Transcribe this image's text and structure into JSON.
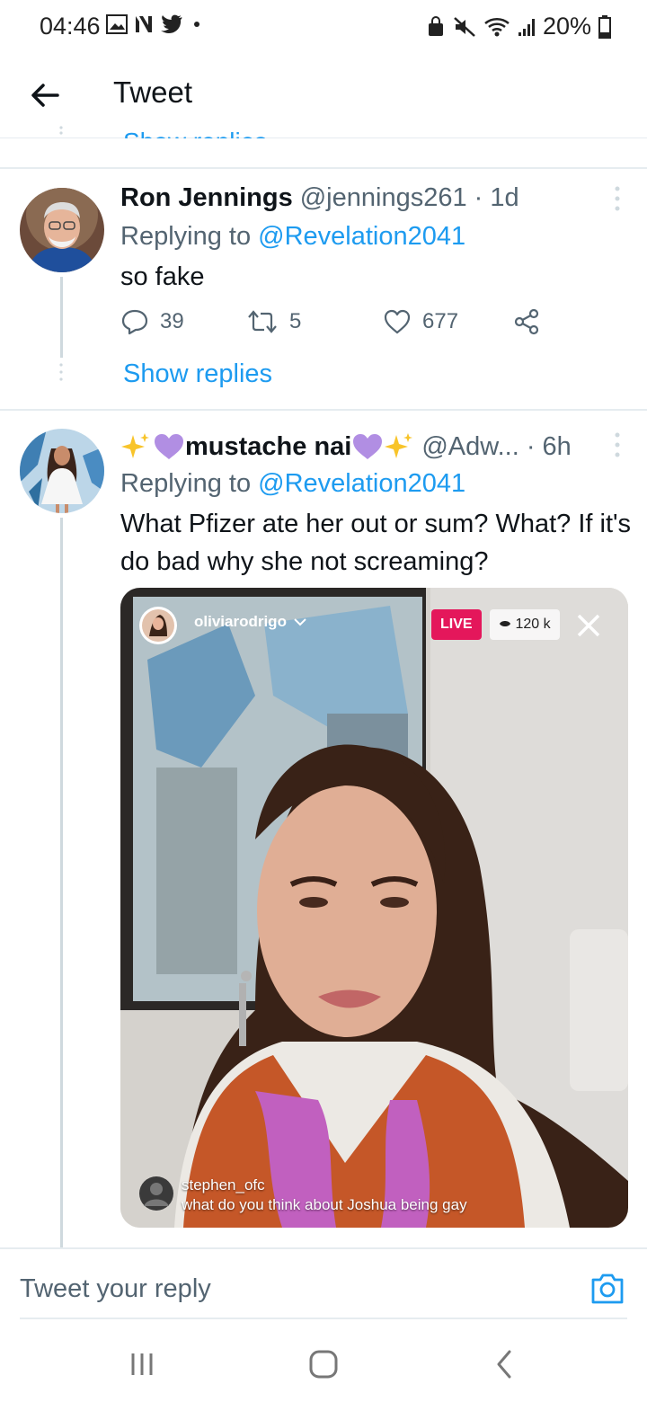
{
  "status": {
    "time": "04:46",
    "battery": "20%"
  },
  "header": {
    "title": "Tweet"
  },
  "prev": {
    "show_replies_clipped": "Show replies"
  },
  "tweet1": {
    "name": "Ron Jennings",
    "handle": "@jennings261 · 1d",
    "replying_prefix": "Replying to",
    "replying_to": "@Revelation2041",
    "text": "so fake",
    "replies": "39",
    "retweets": "5",
    "likes": "677",
    "show_replies": "Show replies"
  },
  "tweet2": {
    "name": "mustache nai",
    "handle": "@Adw... · 6h",
    "replying_prefix": "Replying to",
    "replying_to": "@Revelation2041",
    "text": "What Pfizer ate her out or sum? What? If it's do bad why she not screaming?",
    "media": {
      "ig_username": "oliviarodrigo",
      "live_label": "LIVE",
      "viewers": "120 k",
      "comment_user": "stephen_ofc",
      "comment_text": "what do you think about Joshua being gay"
    }
  },
  "reply_bar": {
    "placeholder": "Tweet your reply"
  },
  "colors": {
    "accent": "#1d9bf0",
    "text": "#0f1419",
    "secondary": "#536471",
    "live": "#e4175b"
  }
}
